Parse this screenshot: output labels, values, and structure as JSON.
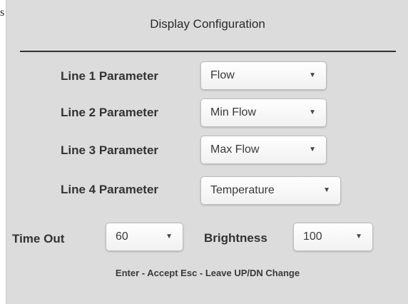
{
  "edge_fragment": "s",
  "panel": {
    "title": "Display Configuration",
    "lines": [
      {
        "label": "Line 1 Parameter",
        "value": "Flow"
      },
      {
        "label": "Line 2 Parameter",
        "value": "Min Flow"
      },
      {
        "label": "Line 3 Parameter",
        "value": "Max Flow"
      },
      {
        "label": "Line 4 Parameter",
        "value": "Temperature"
      }
    ],
    "timeout": {
      "label": "Time Out",
      "value": "60"
    },
    "brightness": {
      "label": "Brightness",
      "value": "100"
    },
    "hint": "Enter - Accept Esc - Leave UP/DN Change"
  },
  "icons": {
    "dropdown_caret": "chevron-down-icon"
  }
}
